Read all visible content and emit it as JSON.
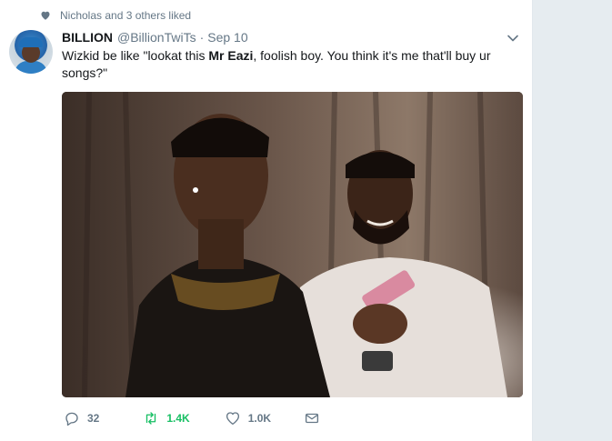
{
  "social_context": {
    "text": "Nicholas and 3 others liked",
    "icon": "heart-icon"
  },
  "tweet": {
    "name": "BILLION",
    "handle": "@BillionTwiTs",
    "separator": "·",
    "date": "Sep 10",
    "text_before": "Wizkid be like \"lookat this ",
    "text_bold": "Mr Eazi",
    "text_after": ", foolish boy. You think it's me that'll buy ur songs?\"",
    "media_icon": "photo-two-men-looking-at-phone"
  },
  "actions": {
    "reply_count": "32",
    "retweet_count": "1.4K",
    "like_count": "1.0K"
  },
  "colors": {
    "retweeted_green": "#17bf63",
    "muted": "#657786",
    "background": "#e6ecf0"
  }
}
